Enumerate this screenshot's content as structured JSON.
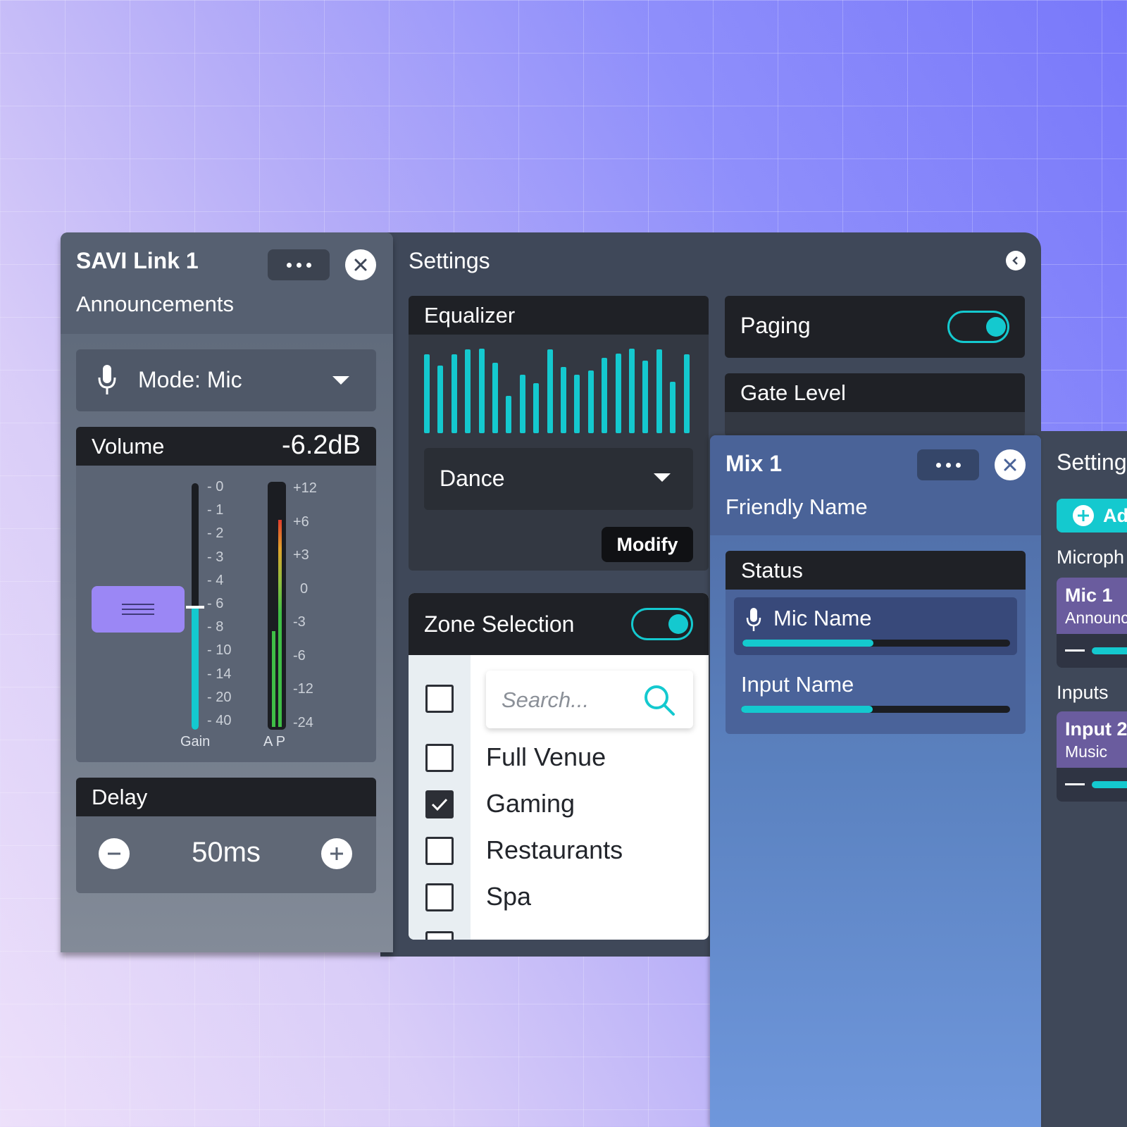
{
  "savi": {
    "title": "SAVI Link 1",
    "subtitle": "Announcements",
    "mode_label": "Mode: Mic",
    "volume_label": "Volume",
    "volume_value": "-6.2dB",
    "gain_ticks": [
      "- 0",
      "- 1",
      "- 2",
      "- 3",
      "- 4",
      "- 6",
      "- 8",
      "- 10",
      "- 14",
      "- 20",
      "- 40"
    ],
    "gain_label": "Gain",
    "meter_ticks": [
      "+12",
      "+6",
      "+3",
      "0",
      "-3",
      "-6",
      "-12",
      "-24"
    ],
    "meter_label": "A P",
    "delay_label": "Delay",
    "delay_value": "50ms"
  },
  "settings": {
    "title": "Settings",
    "equalizer_label": "Equalizer",
    "eq_bars": [
      0.93,
      0.8,
      0.93,
      0.99,
      1.0,
      0.83,
      0.44,
      0.69,
      0.59,
      0.99,
      0.78,
      0.69,
      0.74,
      0.89,
      0.94,
      1.0,
      0.86,
      0.99,
      0.61,
      0.93
    ],
    "eq_preset": "Dance",
    "modify_label": "Modify",
    "paging_label": "Paging",
    "paging_on": true,
    "gate_label": "Gate Level",
    "zone_label": "Zone Selection",
    "zone_on": true,
    "search_placeholder": "Search...",
    "zones": [
      {
        "label": "Full Venue",
        "checked": false
      },
      {
        "label": "Gaming",
        "checked": true
      },
      {
        "label": "Restaurants",
        "checked": false
      },
      {
        "label": "Spa",
        "checked": false
      }
    ]
  },
  "mix": {
    "title": "Mix 1",
    "subtitle": "Friendly Name",
    "status_label": "Status",
    "mic_name": "Mic Name",
    "mic_level": 0.49,
    "input_name": "Input Name",
    "input_level": 0.49
  },
  "right": {
    "title": "Setting",
    "add_label": "Ad",
    "mic_section": "Microph",
    "mic_card_title": "Mic 1",
    "mic_card_sub": "Announc",
    "inputs_section": "Inputs",
    "input_card_title": "Input 2",
    "input_card_sub": "Music"
  },
  "colors": {
    "accent": "#14c9cf",
    "fader": "#9b87f5"
  }
}
